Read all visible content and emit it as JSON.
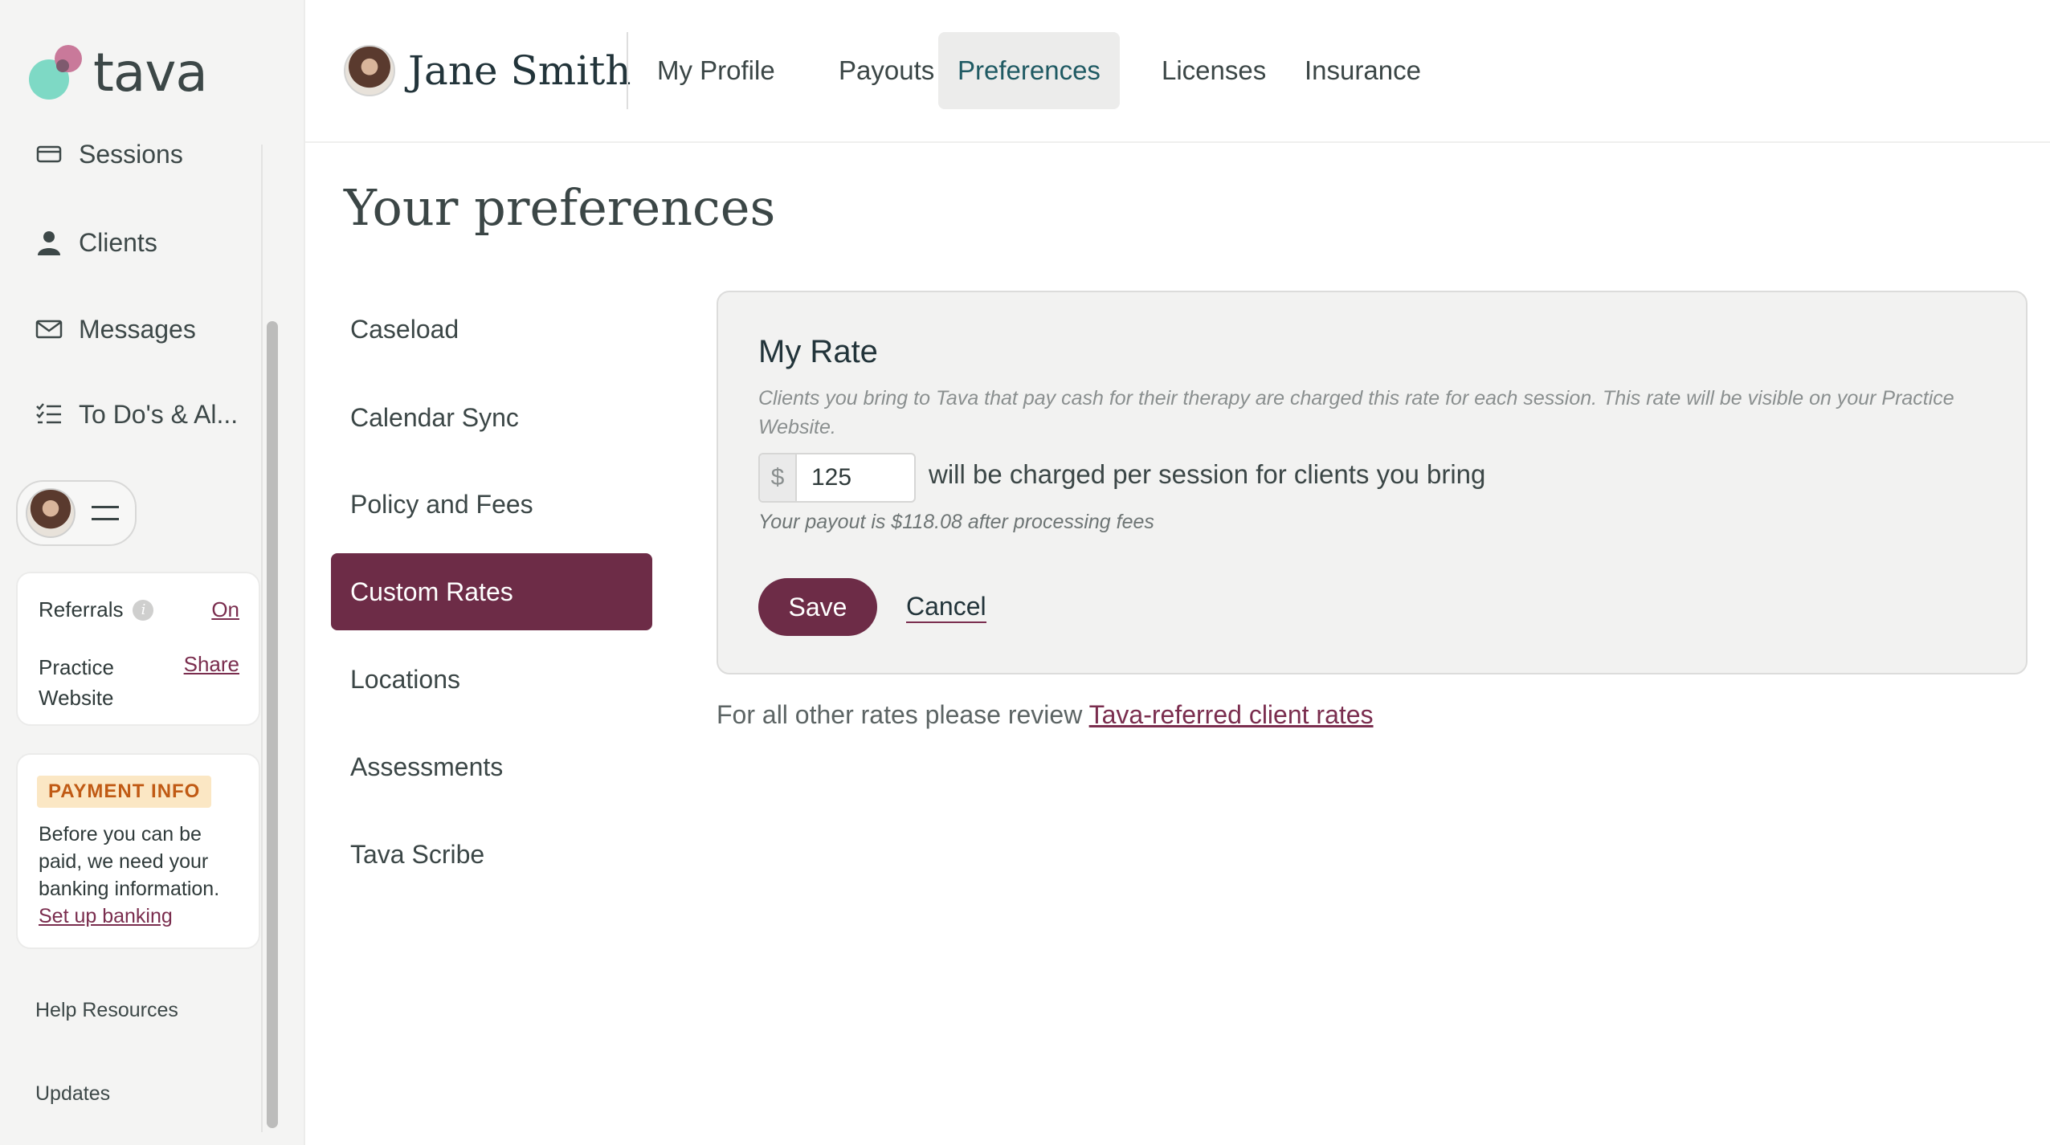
{
  "brand": {
    "name": "tava"
  },
  "sidebar": {
    "items": [
      {
        "label": "Sessions",
        "icon": "card-icon"
      },
      {
        "label": "Clients",
        "icon": "person-icon"
      },
      {
        "label": "Messages",
        "icon": "envelope-icon"
      },
      {
        "label": "To Do's & Al...",
        "icon": "checklist-icon"
      }
    ],
    "referrals": {
      "label": "Referrals",
      "status": "On"
    },
    "practice_website": {
      "label": "Practice Website",
      "action": "Share"
    },
    "payment": {
      "badge": "PAYMENT INFO",
      "text": "Before you can be paid, we need your banking information.",
      "link": "Set up banking"
    },
    "footer": [
      "Help Resources",
      "Updates"
    ]
  },
  "header": {
    "user_name": "Jane Smith",
    "tabs": [
      {
        "label": "My Profile",
        "active": false
      },
      {
        "label": "Payouts",
        "active": false
      },
      {
        "label": "Preferences",
        "active": true
      },
      {
        "label": "Licenses",
        "active": false
      },
      {
        "label": "Insurance",
        "active": false
      }
    ]
  },
  "main": {
    "title": "Your preferences",
    "subnav": [
      {
        "label": "Caseload",
        "active": false
      },
      {
        "label": "Calendar Sync",
        "active": false
      },
      {
        "label": "Policy and Fees",
        "active": false
      },
      {
        "label": "Custom Rates",
        "active": true
      },
      {
        "label": "Locations",
        "active": false
      },
      {
        "label": "Assessments",
        "active": false
      },
      {
        "label": "Tava Scribe",
        "active": false
      }
    ],
    "rate": {
      "title": "My Rate",
      "description": "Clients you bring to Tava that pay cash for their therapy are charged this rate for each session. This rate will be visible on your Practice Website.",
      "currency": "$",
      "value": "125",
      "suffix": "will be charged per session for clients you bring",
      "payout_note": "Your payout is $118.08 after processing fees",
      "save_label": "Save",
      "cancel_label": "Cancel"
    },
    "other_rates": {
      "text": "For all other rates please review",
      "link": "Tava-referred client rates"
    }
  },
  "colors": {
    "accent": "#6d2c47",
    "teal": "#1f5a63",
    "link": "#7a2d4e",
    "badge_bg": "#fbe7c4",
    "badge_text": "#c05a14"
  }
}
